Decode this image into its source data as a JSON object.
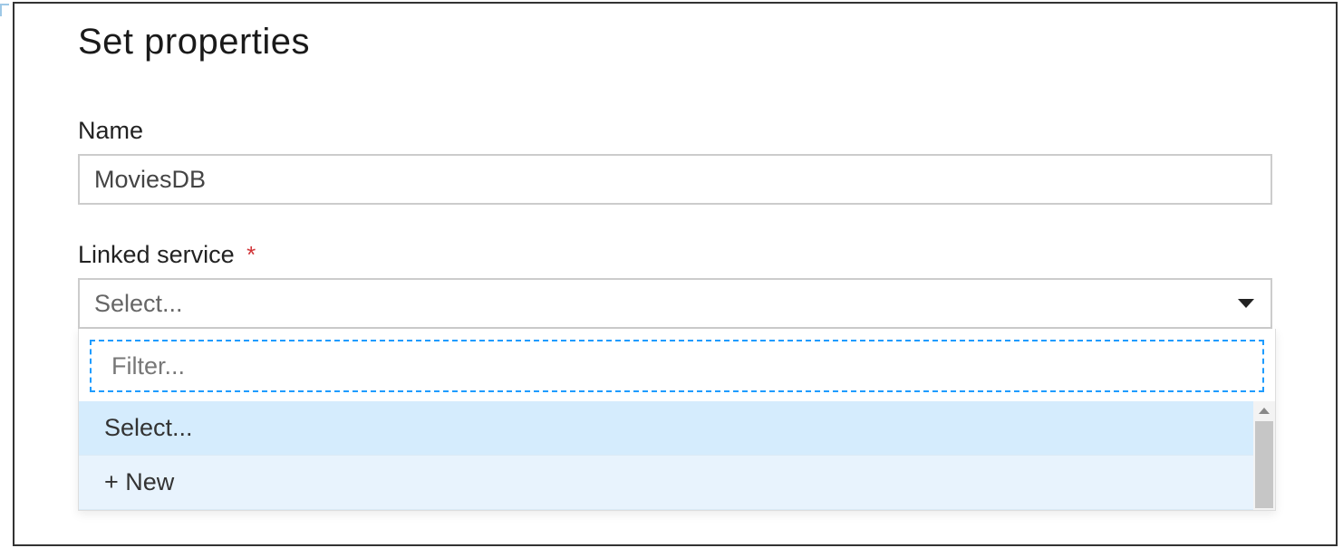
{
  "page": {
    "title": "Set properties"
  },
  "form": {
    "name": {
      "label": "Name",
      "value": "MoviesDB"
    },
    "linked_service": {
      "label": "Linked service",
      "required_marker": "*",
      "placeholder": "Select...",
      "filter_placeholder": "Filter...",
      "options": [
        {
          "label": "Select...",
          "selected": true
        },
        {
          "label": "+ New",
          "selected": false
        }
      ]
    }
  }
}
